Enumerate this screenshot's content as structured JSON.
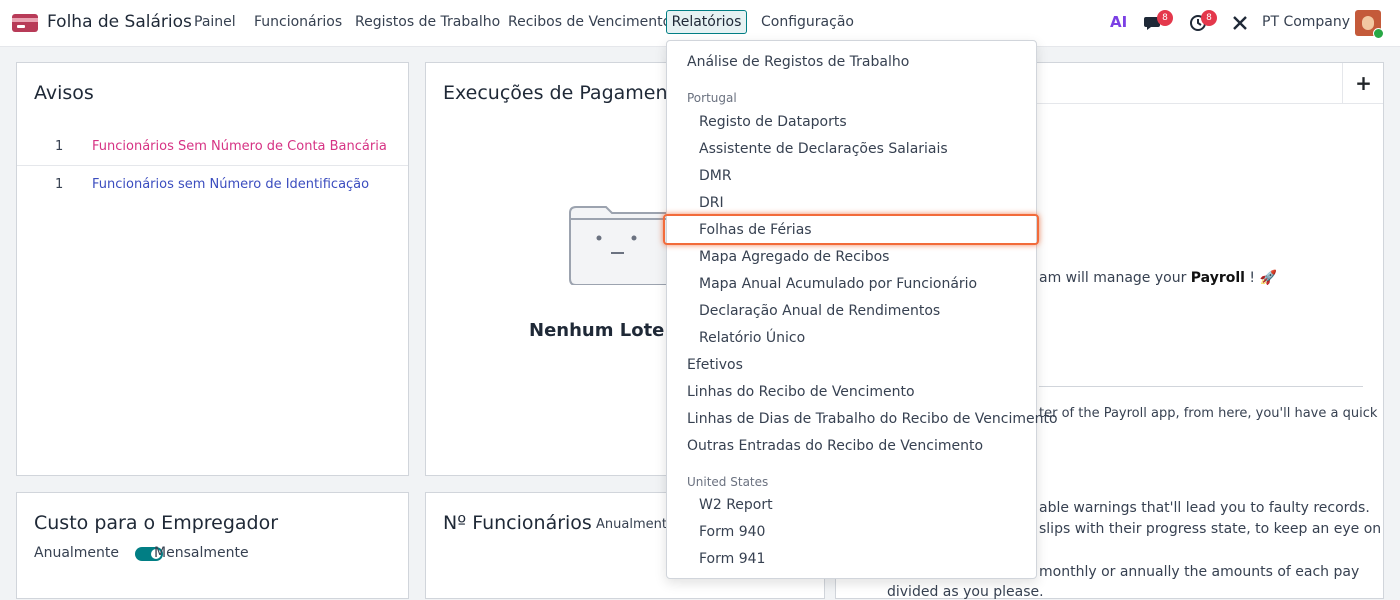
{
  "app": {
    "title": "Folha de Salários"
  },
  "nav": {
    "items": [
      "Painel",
      "Funcionários",
      "Registos de Trabalho",
      "Recibos de Vencimento",
      "Relatórios",
      "Configuração"
    ],
    "active": "Relatórios"
  },
  "systray": {
    "ai_label": "AI",
    "messages_count": "8",
    "activities_count": "8",
    "company": "PT Company"
  },
  "warnings": {
    "title": "Avisos",
    "rows": [
      {
        "count": "1",
        "label": "Funcionários Sem Número de Conta Bancária",
        "color": "#d63384"
      },
      {
        "count": "1",
        "label": "Funcionários sem Número de Identificação",
        "color": "#3b4dbf"
      }
    ]
  },
  "payruns": {
    "title": "Execuções de Pagamen",
    "empty_text": "Nenhum Lote A"
  },
  "cost": {
    "title": "Custo para o Empregador",
    "toggle_left": "Anualmente",
    "toggle_right": "Mensalmente"
  },
  "headcount": {
    "title": "Nº Funcionários",
    "toggle_left": "Anualmente"
  },
  "welcome": {
    "add_button": "+",
    "line1_prefix": "am will manage your ",
    "line1_bold": "Payroll",
    "line1_suffix": " ! 🚀",
    "line2": "ter of the Payroll app, from here, you'll have a quick",
    "line3": "able warnings that'll lead you to faulty records.",
    "line4": "slips with their progress state, to keep an eye on",
    "line5": "monthly or annually the amounts of each pay",
    "line6": "divided as you please."
  },
  "reports_menu": {
    "top_item": "Análise de Registos de Trabalho",
    "portugal_header": "Portugal",
    "portugal_items": [
      "Registo de Dataports",
      "Assistente de Declarações Salariais",
      "DMR",
      "DRI",
      "Folhas de Férias",
      "Mapa Agregado de Recibos",
      "Mapa Anual Acumulado por Funcionário",
      "Declaração Anual de Rendimentos",
      "Relatório Único"
    ],
    "general_items": [
      "Efetivos",
      "Linhas do Recibo de Vencimento",
      "Linhas de Dias de Trabalho do Recibo de Vencimento",
      "Outras Entradas do Recibo de Vencimento"
    ],
    "us_header": "United States",
    "us_items": [
      "W2 Report",
      "Form 940",
      "Form 941"
    ],
    "highlighted": "Folhas de Férias"
  }
}
